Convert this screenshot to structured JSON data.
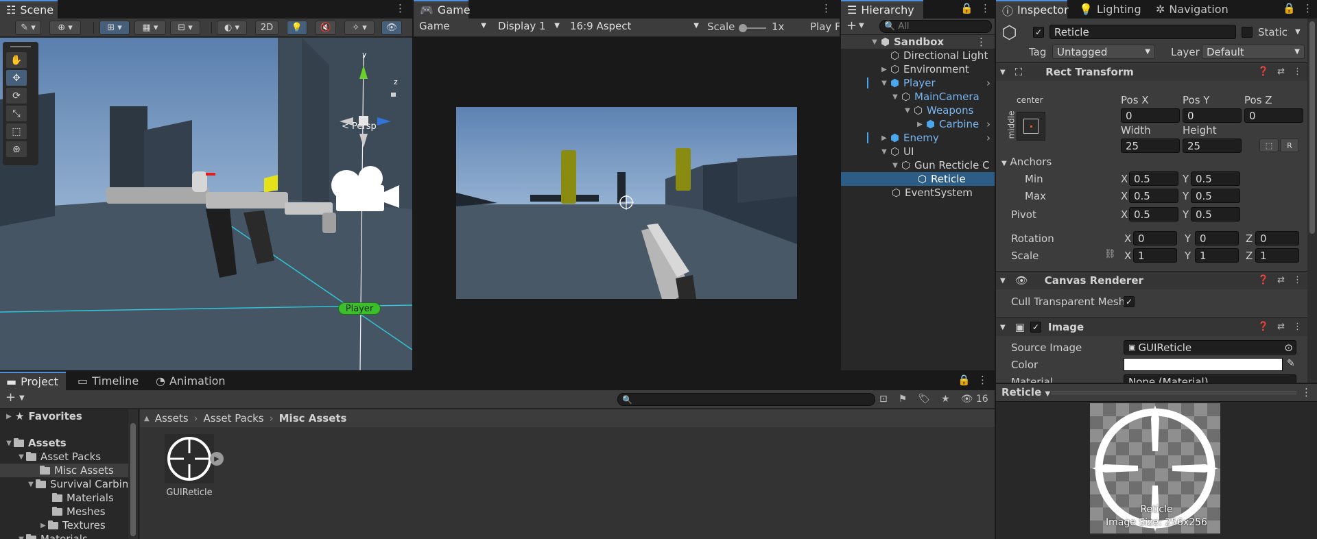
{
  "scene": {
    "tab": "Scene",
    "toolbar": {
      "btn_2d": "2D"
    },
    "overlay": {
      "persp_label": "< Persp",
      "axis_y": "y",
      "axis_z": "z",
      "player_tag": "Player"
    }
  },
  "game": {
    "tab": "Game",
    "toolbar": {
      "mode": "Game",
      "display": "Display 1",
      "aspect": "16:9 Aspect",
      "scale_label": "Scale",
      "scale_value": "1x",
      "play_label": "Play F"
    }
  },
  "hierarchy": {
    "tab": "Hierarchy",
    "search_placeholder": "All",
    "add_label": "+",
    "scene_name": "Sandbox",
    "items": [
      {
        "label": "Directional Light"
      },
      {
        "label": "Environment"
      },
      {
        "label": "Player"
      },
      {
        "label": "MainCamera"
      },
      {
        "label": "Weapons"
      },
      {
        "label": "Carbine"
      },
      {
        "label": "Enemy"
      },
      {
        "label": "UI"
      },
      {
        "label": "Gun Recticle C"
      },
      {
        "label": "Reticle"
      },
      {
        "label": "EventSystem"
      }
    ]
  },
  "inspector": {
    "tabs": [
      "Inspector",
      "Lighting",
      "Navigation"
    ],
    "object_name": "Reticle",
    "static_label": "Static",
    "tag_label": "Tag",
    "tag_value": "Untagged",
    "layer_label": "Layer",
    "layer_value": "Default",
    "rect": {
      "title": "Rect Transform",
      "anchor_h": "center",
      "anchor_v": "middle",
      "pos_x_label": "Pos X",
      "pos_y_label": "Pos Y",
      "pos_z_label": "Pos Z",
      "pos_x": "0",
      "pos_y": "0",
      "pos_z": "0",
      "width_label": "Width",
      "height_label": "Height",
      "width": "25",
      "height": "25",
      "r_label": "R",
      "anchors_label": "Anchors",
      "min_label": "Min",
      "max_label": "Max",
      "min_x": "0.5",
      "min_y": "0.5",
      "max_x": "0.5",
      "max_y": "0.5",
      "pivot_label": "Pivot",
      "pivot_x": "0.5",
      "pivot_y": "0.5",
      "rotation_label": "Rotation",
      "rot_x": "0",
      "rot_y": "0",
      "rot_z": "0",
      "scale_label": "Scale",
      "scale_x": "1",
      "scale_y": "1",
      "scale_z": "1",
      "x": "X",
      "y": "Y",
      "z": "Z"
    },
    "canvas": {
      "title": "Canvas Renderer",
      "cull_label": "Cull Transparent Mesh"
    },
    "image": {
      "title": "Image",
      "source_label": "Source Image",
      "source_value": "GUIReticle",
      "color_label": "Color",
      "color_value": "#ffffff",
      "material_label": "Material",
      "material_value": "None (Material)"
    }
  },
  "preview": {
    "title": "Reticle",
    "name": "Reticle",
    "size": "Image Size: 256x256"
  },
  "project": {
    "tabs": [
      "Project",
      "Timeline",
      "Animation"
    ],
    "add_label": "+",
    "hidden_count": "16",
    "favorites": "Favorites",
    "tree": [
      {
        "label": "Assets"
      },
      {
        "label": "Asset Packs"
      },
      {
        "label": "Misc Assets"
      },
      {
        "label": "Survival Carbine"
      },
      {
        "label": "Materials"
      },
      {
        "label": "Meshes"
      },
      {
        "label": "Textures"
      },
      {
        "label": "Materials"
      }
    ],
    "breadcrumb": [
      "Assets",
      "Asset Packs",
      "Misc Assets"
    ],
    "asset_name": "GUIReticle"
  },
  "colors": {
    "accent": "#4d8fd8",
    "selection": "#2c5d87",
    "prefab_blue": "#4aa7ee",
    "panel": "#282828"
  }
}
